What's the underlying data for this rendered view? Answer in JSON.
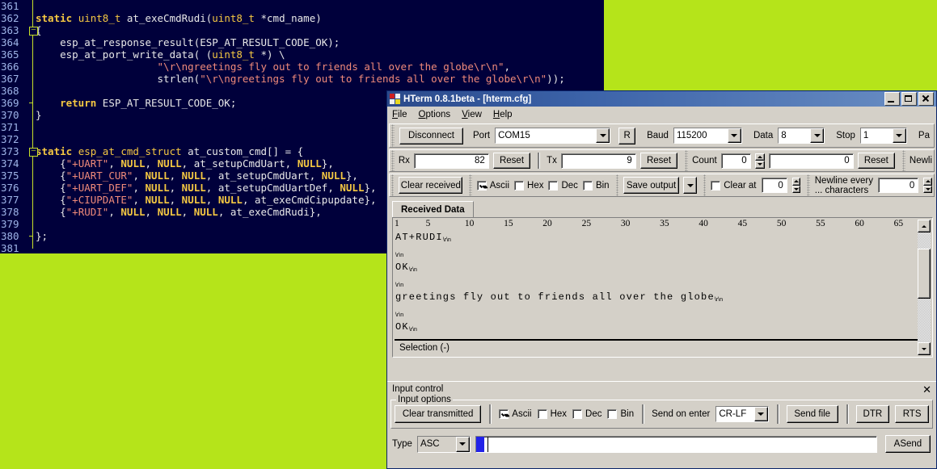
{
  "desktop": {
    "background_color": "#b5e41a"
  },
  "editor": {
    "background_color": "#00003b",
    "line_number_color": "#9fb5e8",
    "string_color": "#f08a7a",
    "keyword_color": "#f5c842",
    "first_line": 361,
    "lines": [
      {
        "num": "361",
        "text": ""
      },
      {
        "num": "362",
        "text": "static uint8_t at_exeCmdRudi(uint8_t *cmd_name)"
      },
      {
        "num": "363",
        "text": "{"
      },
      {
        "num": "364",
        "text": "    esp_at_response_result(ESP_AT_RESULT_CODE_OK);"
      },
      {
        "num": "365",
        "text": "    esp_at_port_write_data( (uint8_t *) \\"
      },
      {
        "num": "366",
        "text": "                    \"\\r\\ngreetings fly out to friends all over the globe\\r\\n\","
      },
      {
        "num": "367",
        "text": "                    strlen(\"\\r\\ngreetings fly out to friends all over the globe\\r\\n\"));"
      },
      {
        "num": "368",
        "text": ""
      },
      {
        "num": "369",
        "text": "    return ESP_AT_RESULT_CODE_OK;"
      },
      {
        "num": "370",
        "text": "}"
      },
      {
        "num": "371",
        "text": ""
      },
      {
        "num": "372",
        "text": ""
      },
      {
        "num": "373",
        "text": "static esp_at_cmd_struct at_custom_cmd[] = {"
      },
      {
        "num": "374",
        "text": "    {\"+UART\", NULL, NULL, at_setupCmdUart, NULL},"
      },
      {
        "num": "375",
        "text": "    {\"+UART_CUR\", NULL, NULL, at_setupCmdUart, NULL},"
      },
      {
        "num": "376",
        "text": "    {\"+UART_DEF\", NULL, NULL, at_setupCmdUartDef, NULL},"
      },
      {
        "num": "377",
        "text": "    {\"+CIUPDATE\", NULL, NULL, NULL, at_exeCmdCipupdate},"
      },
      {
        "num": "378",
        "text": "    {\"+RUDI\", NULL, NULL, NULL, at_exeCmdRudi},"
      },
      {
        "num": "379",
        "text": ""
      },
      {
        "num": "380",
        "text": "};"
      },
      {
        "num": "381",
        "text": ""
      }
    ]
  },
  "hterm": {
    "title": "HTerm 0.8.1beta - [hterm.cfg]",
    "window_buttons": {
      "minimize": "minimize-button",
      "maximize": "maximize-button",
      "close": "close-button"
    },
    "menu": [
      "File",
      "Options",
      "View",
      "Help"
    ],
    "connection_bar": {
      "disconnect_label": "Disconnect",
      "port_label": "Port",
      "port_value": "COM15",
      "refresh_label": "R",
      "baud_label": "Baud",
      "baud_value": "115200",
      "data_label": "Data",
      "data_value": "8",
      "stop_label": "Stop",
      "stop_value": "1",
      "parity_label": "Pa"
    },
    "counter_bar": {
      "rx_label": "Rx",
      "rx_value": "82",
      "rx_reset_label": "Reset",
      "tx_label": "Tx",
      "tx_value": "9",
      "tx_reset_label": "Reset",
      "count_label": "Count",
      "count_value": "0",
      "count_total": "0",
      "count_reset_label": "Reset",
      "newline_label": "Newli"
    },
    "options_bar": {
      "clear_received_label": "Clear received",
      "ascii_label": "Ascii",
      "ascii_checked": true,
      "hex_label": "Hex",
      "hex_checked": false,
      "dec_label": "Dec",
      "dec_checked": false,
      "bin_label": "Bin",
      "bin_checked": false,
      "save_output_label": "Save output",
      "clear_at_label": "Clear at",
      "clear_at_checked": false,
      "clear_at_value": "0",
      "newline_every_label_1": "Newline every",
      "newline_every_label_2": "... characters",
      "newline_every_value": "0"
    },
    "received": {
      "tab_label": "Received Data",
      "ruler_ticks": [
        "1",
        "5",
        "10",
        "15",
        "20",
        "25",
        "30",
        "35",
        "40",
        "45",
        "50",
        "55",
        "60",
        "65"
      ],
      "lines": [
        {
          "text": "AT+RUDI",
          "crlf": true
        },
        {
          "text": "",
          "crlf": true
        },
        {
          "text": "OK",
          "crlf": true
        },
        {
          "text": "",
          "crlf": true
        },
        {
          "text": "greetings fly out to friends all over the globe",
          "crlf": true
        },
        {
          "text": "",
          "crlf": true
        },
        {
          "text": "OK",
          "crlf": true
        }
      ],
      "crlf_glyph": "\\r\\n",
      "selection_label": "Selection (-)"
    },
    "input_control": {
      "title": "Input control",
      "close_glyph": "✕",
      "options_legend": "Input options",
      "clear_transmitted_label": "Clear transmitted",
      "ascii_label": "Ascii",
      "ascii_checked": true,
      "hex_label": "Hex",
      "dec_label": "Dec",
      "bin_label": "Bin",
      "send_on_enter_label": "Send on enter",
      "send_on_enter_value": "CR-LF",
      "send_file_label": "Send file",
      "dtr_label": "DTR",
      "rts_label": "RTS",
      "type_label": "Type",
      "type_value": "ASC",
      "input_value": "",
      "asend_label": "ASend"
    }
  }
}
